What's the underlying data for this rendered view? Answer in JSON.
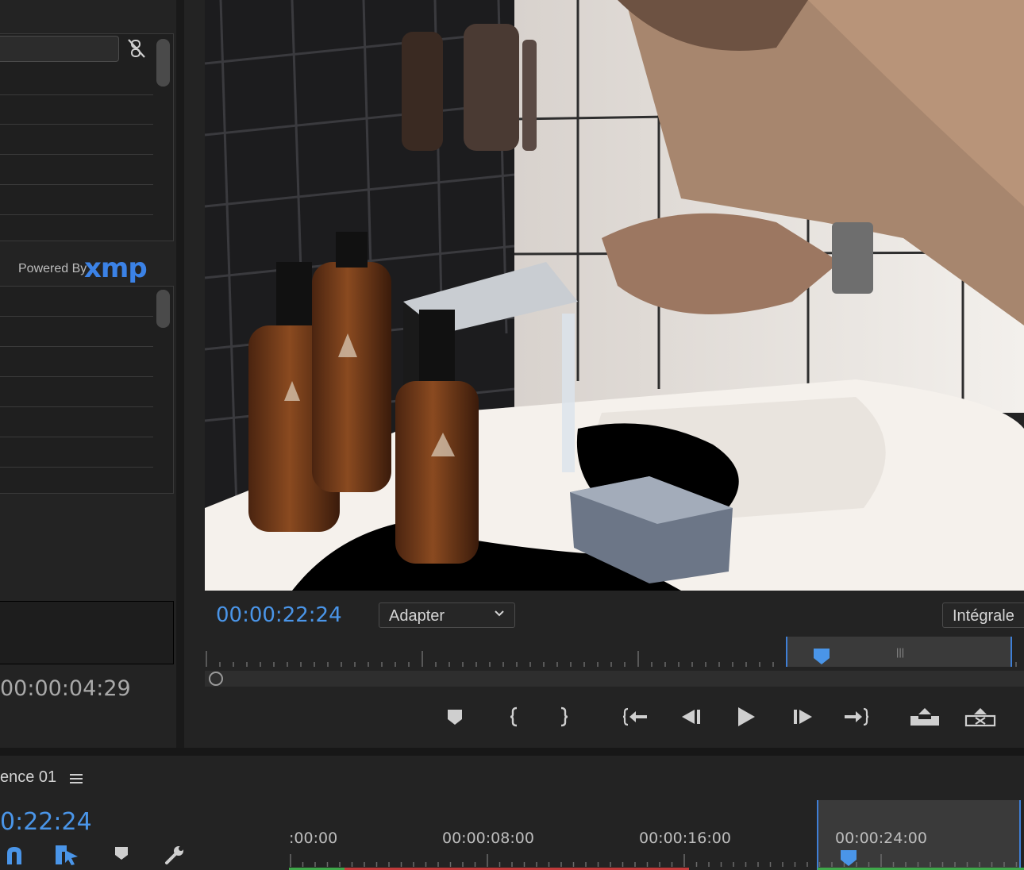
{
  "metadata_panel": {
    "powered_by": "Powered By",
    "xmp_logo": "xmp",
    "duration": "00:00:04:29"
  },
  "monitor": {
    "playhead_timecode": "00:00:22:24",
    "fit_select": "Adapter",
    "resolution_select": "Intégrale"
  },
  "timeline": {
    "sequence_name": "ence 01",
    "playhead_timecode": "0:22:24",
    "ruler_labels": [
      ":00:00",
      "00:00:08:00",
      "00:00:16:00",
      "00:00:24:00"
    ]
  },
  "colors": {
    "accent_blue": "#4a95e8",
    "xmp_blue": "#3b82e6",
    "panel_bg": "#232323",
    "render_bar_red": "#c23b3b",
    "render_bar_green": "#3fa84a"
  }
}
